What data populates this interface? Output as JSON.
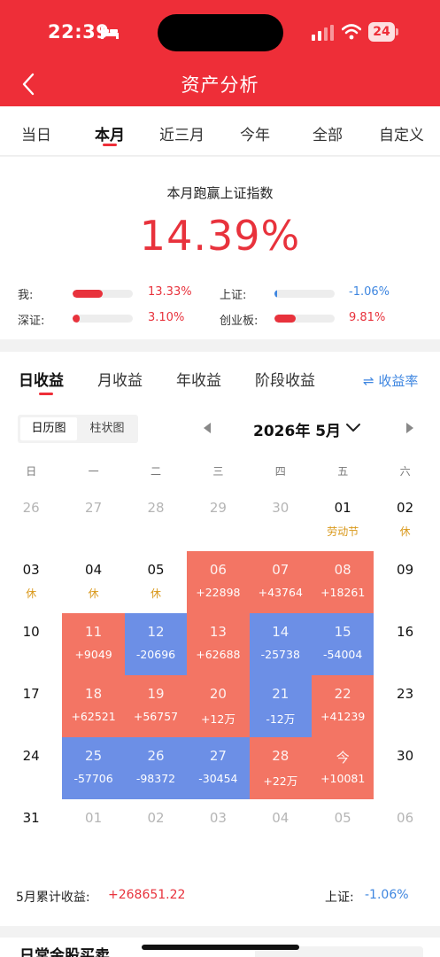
{
  "status": {
    "time": "22:39",
    "battery": "24"
  },
  "nav": {
    "title": "资产分析"
  },
  "period_tabs": [
    "当日",
    "本月",
    "近三月",
    "今年",
    "全部",
    "自定义"
  ],
  "summary": {
    "title": "本月跑赢上证指数",
    "value": "14.39%",
    "compare": [
      {
        "label": "我:",
        "value": "13.33%",
        "level": 0.5,
        "color": "#e8323c"
      },
      {
        "label": "上证:",
        "value": "-1.06%",
        "level": 0.04,
        "color": "#3e86e0"
      },
      {
        "label": "深证:",
        "value": "3.10%",
        "level": 0.12,
        "color": "#e8323c"
      },
      {
        "label": "创业板:",
        "value": "9.81%",
        "level": 0.36,
        "color": "#e8323c"
      }
    ]
  },
  "return_tabs": [
    "日收益",
    "月收益",
    "年收益",
    "阶段收益"
  ],
  "rate_toggle": "⇌ 收益率",
  "view_toggle": [
    "日历图",
    "柱状图"
  ],
  "month_label": "2026年 5月",
  "weekdays": [
    "日",
    "一",
    "二",
    "三",
    "四",
    "五",
    "六"
  ],
  "weeks": [
    [
      {
        "d": "26",
        "t": "gray"
      },
      {
        "d": "27",
        "t": "gray"
      },
      {
        "d": "28",
        "t": "gray"
      },
      {
        "d": "29",
        "t": "gray"
      },
      {
        "d": "30",
        "t": "gray"
      },
      {
        "d": "01",
        "s": "劳动节",
        "t": "holiday"
      },
      {
        "d": "02",
        "s": "休",
        "t": "holiday"
      }
    ],
    [
      {
        "d": "03",
        "s": "休",
        "t": "holiday"
      },
      {
        "d": "04",
        "s": "休",
        "t": "holiday"
      },
      {
        "d": "05",
        "s": "休",
        "t": "holiday"
      },
      {
        "d": "06",
        "s": "+22898",
        "t": "gain"
      },
      {
        "d": "07",
        "s": "+43764",
        "t": "gain"
      },
      {
        "d": "08",
        "s": "+18261",
        "t": "gain"
      },
      {
        "d": "09",
        "t": "plain"
      }
    ],
    [
      {
        "d": "10",
        "t": "plain"
      },
      {
        "d": "11",
        "s": "+9049",
        "t": "gain"
      },
      {
        "d": "12",
        "s": "-20696",
        "t": "loss"
      },
      {
        "d": "13",
        "s": "+62688",
        "t": "gain"
      },
      {
        "d": "14",
        "s": "-25738",
        "t": "loss"
      },
      {
        "d": "15",
        "s": "-54004",
        "t": "loss"
      },
      {
        "d": "16",
        "t": "plain"
      }
    ],
    [
      {
        "d": "17",
        "t": "plain"
      },
      {
        "d": "18",
        "s": "+62521",
        "t": "gain"
      },
      {
        "d": "19",
        "s": "+56757",
        "t": "gain"
      },
      {
        "d": "20",
        "s": "+12万",
        "t": "gain"
      },
      {
        "d": "21",
        "s": "-12万",
        "t": "loss"
      },
      {
        "d": "22",
        "s": "+41239",
        "t": "gain"
      },
      {
        "d": "23",
        "t": "plain"
      }
    ],
    [
      {
        "d": "24",
        "t": "plain"
      },
      {
        "d": "25",
        "s": "-57706",
        "t": "loss"
      },
      {
        "d": "26",
        "s": "-98372",
        "t": "loss"
      },
      {
        "d": "27",
        "s": "-30454",
        "t": "loss"
      },
      {
        "d": "28",
        "s": "+22万",
        "t": "gain"
      },
      {
        "d": "今",
        "s": "+10081",
        "t": "gain"
      },
      {
        "d": "30",
        "t": "plain"
      }
    ],
    [
      {
        "d": "31",
        "t": "plain"
      },
      {
        "d": "01",
        "t": "gray"
      },
      {
        "d": "02",
        "t": "gray"
      },
      {
        "d": "03",
        "t": "gray"
      },
      {
        "d": "04",
        "t": "gray"
      },
      {
        "d": "05",
        "t": "gray"
      },
      {
        "d": "06",
        "t": "gray"
      }
    ]
  ],
  "totals": {
    "label": "5月累计收益:",
    "value": "+268651.22",
    "index_label": "上证:",
    "index_value": "-1.06%"
  },
  "bottom": {
    "title": "日常金股买卖"
  }
}
